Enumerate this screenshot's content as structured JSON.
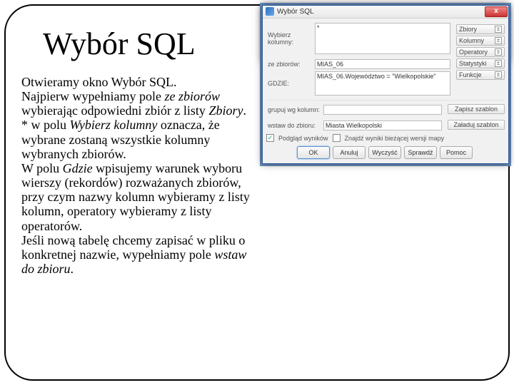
{
  "title": "Wybór SQL",
  "paragraph": {
    "t1": "Otwieramy okno Wybór SQL.",
    "t2a": " Najpierw wypełniamy pole ",
    "t2i": "ze zbiorów",
    "t2b": " wybierając odpowiedni zbiór z listy ",
    "t2c": "Zbiory",
    "t2d": ".",
    "t3a": "* w polu ",
    "t3i": "Wybierz kolumny",
    "t3b": " oznacza, że wybrane zostaną wszystkie kolumny wybranych zbiorów.",
    "t4a": "W polu ",
    "t4i": "Gdzie",
    "t4b": " wpisujemy warunek wyboru wierszy (rekordów) rozważanych zbiorów, przy czym nazwy kolumn wybieramy z listy kolumn, operatory wybieramy z listy operatorów.",
    "t5a": "Jeśli nową tabelę chcemy zapisać w pliku o konkretnej nazwie, wypełniamy pole ",
    "t5i": "wstaw do zbioru",
    "t5b": "."
  },
  "dialog": {
    "title": "Wybór SQL",
    "close": "x",
    "labels": {
      "wybierz_kolumny": "Wybierz kolumny:",
      "ze_zbiorow": "ze zbiorów:",
      "gdzie": "GDZIE:",
      "grupuj": "grupuj wg kolumn:",
      "wstaw": "wstaw do zbioru:"
    },
    "fields": {
      "wybierz_kolumny": "*",
      "ze_zbiorow": "MIAS_06",
      "gdzie": "MIAS_06.Województwo = \"Wielkopolskie\"",
      "grupuj": "",
      "wstaw": "Miasta Wielkopolski"
    },
    "side_buttons": {
      "zbiory": "Zbiory",
      "kolumny": "Kolumny",
      "operatory": "Operatory",
      "statystyki": "Statystyki",
      "funkcje": "Funkcje",
      "zapisz_szablon": "Zapisz szablon",
      "zaladuj_szablon": "Załaduj szablon"
    },
    "side_glyph": "±",
    "checkboxes": {
      "pogladaj": "Podgląd wyników",
      "znajdz": "Znajdź wyniki bieżącej wersji mapy"
    },
    "checked_mark": "✓",
    "buttons": {
      "ok": "OK",
      "anuluj": "Anuluj",
      "wyczysc": "Wyczyść",
      "sprawdz": "Sprawdź",
      "pomoc": "Pomoc"
    }
  }
}
